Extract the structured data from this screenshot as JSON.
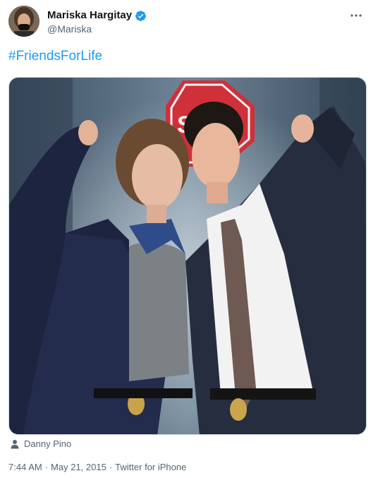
{
  "author": {
    "display_name": "Mariska Hargitay",
    "handle": "@Mariska",
    "verified": true
  },
  "tweet": {
    "text": "#FriendsForLife"
  },
  "media": {
    "kind": "photo",
    "sign_text": "STOP"
  },
  "tagged": {
    "name": "Danny Pino",
    "icon": "person-icon"
  },
  "meta": {
    "time": "7:44 AM",
    "separator": "·",
    "date": "May 21, 2015",
    "source": "Twitter for iPhone"
  },
  "colors": {
    "accent": "#1d9bf0",
    "secondary_text": "#536471",
    "primary_text": "#0f1419"
  }
}
